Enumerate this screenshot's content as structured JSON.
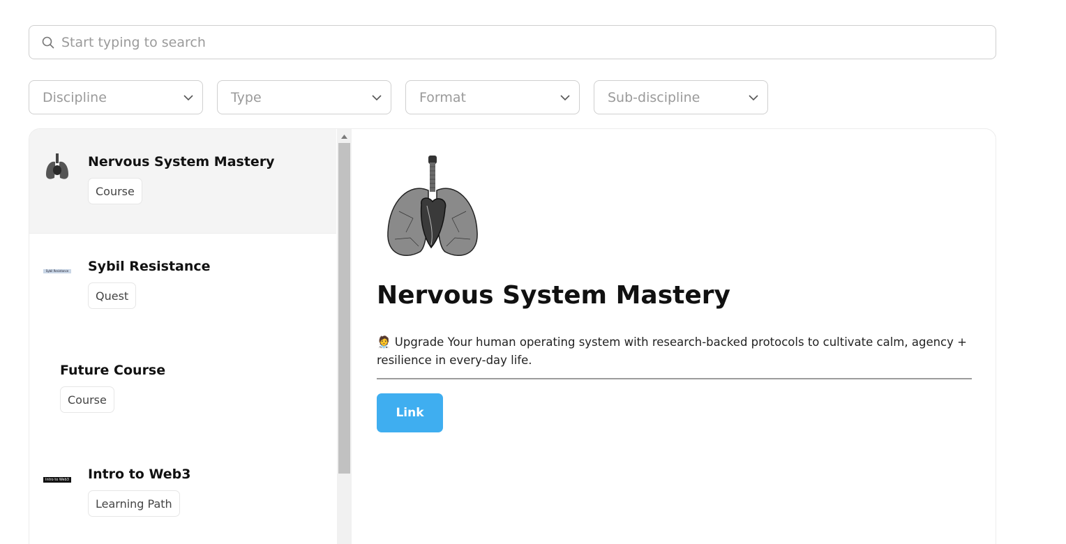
{
  "search": {
    "placeholder": "Start typing to search"
  },
  "filters": [
    {
      "label": "Discipline"
    },
    {
      "label": "Type"
    },
    {
      "label": "Format"
    },
    {
      "label": "Sub-discipline"
    }
  ],
  "list": {
    "items": [
      {
        "title": "Nervous System Mastery",
        "badge": "Course",
        "thumb": "lungs-heart-icon",
        "active": true
      },
      {
        "title": "Sybil Resistance",
        "badge": "Quest",
        "thumb": "sybil-resistance-thumbnail",
        "thumb_text": "Sybil Resistance"
      },
      {
        "title": "Future Course",
        "badge": "Course"
      },
      {
        "title": "Intro to Web3",
        "badge": "Learning Path",
        "thumb": "intro-to-web3-thumbnail",
        "thumb_text": "Intro to Web3"
      }
    ]
  },
  "detail": {
    "title": "Nervous System Mastery",
    "description": "🧑‍⚕️ Upgrade Your human operating system with research-backed protocols to cultivate calm, agency + resilience in every-day life.",
    "link_label": "Link",
    "image": "lungs-heart-illustration"
  },
  "colors": {
    "accent": "#3faef0",
    "active_row": "#f4f4f4",
    "border": "#cfcfcf"
  }
}
